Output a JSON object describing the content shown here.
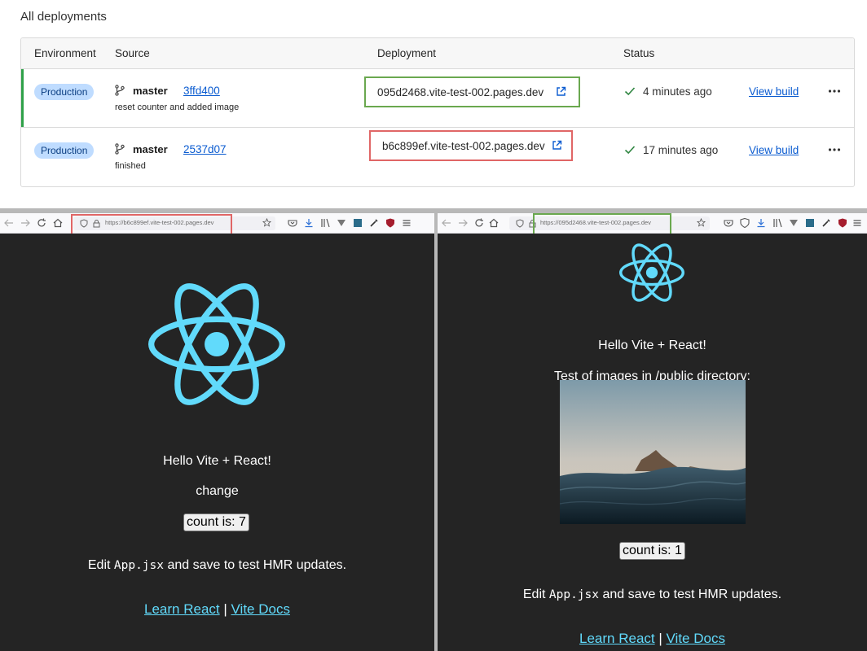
{
  "deployments": {
    "title": "All deployments",
    "columns": [
      "Environment",
      "Source",
      "Deployment",
      "Status"
    ],
    "rows": [
      {
        "environment": "Production",
        "branch": "master",
        "commit": "3ffd400",
        "message": "reset counter and added image",
        "deployment_url": "095d2468.vite-test-002.pages.dev",
        "status": "4 minutes ago",
        "action": "View build",
        "highlight_color": "#6aa84f",
        "active": true
      },
      {
        "environment": "Production",
        "branch": "master",
        "commit": "2537d07",
        "message": "finished",
        "deployment_url": "b6c899ef.vite-test-002.pages.dev",
        "status": "17 minutes ago",
        "action": "View build",
        "highlight_color": "#e06666",
        "active": false
      }
    ]
  },
  "browsers": {
    "left": {
      "url": "https://b6c899ef.vite-test-002.pages.dev",
      "highlight_color": "#e06666",
      "hello": "Hello Vite + React!",
      "change": "change",
      "count": "count is: 7",
      "edit_pre": "Edit ",
      "edit_code": "App.jsx",
      "edit_post": " and save to test HMR updates.",
      "link_react": "Learn React",
      "separator": " | ",
      "link_vite": "Vite Docs"
    },
    "right": {
      "url": "https://095d2468.vite-test-002.pages.dev",
      "highlight_color": "#6aa84f",
      "hello": "Hello Vite + React!",
      "images_title": "Test of images in /public directory:",
      "count": "count is: 1",
      "edit_pre": "Edit ",
      "edit_code": "App.jsx",
      "edit_post": " and save to test HMR updates.",
      "link_react": "Learn React",
      "separator": " | ",
      "link_vite": "Vite Docs"
    }
  },
  "colors": {
    "react": "#61dafb",
    "page_bg": "#242424",
    "link": "#0a5bd0",
    "badge_bg": "#bfdcff"
  },
  "icons": [
    "branch-icon",
    "external-link-icon",
    "check-icon",
    "more-icon",
    "back-icon",
    "forward-icon",
    "reload-icon",
    "home-icon",
    "shield-icon",
    "lock-icon",
    "star-icon",
    "react-logo-icon"
  ]
}
